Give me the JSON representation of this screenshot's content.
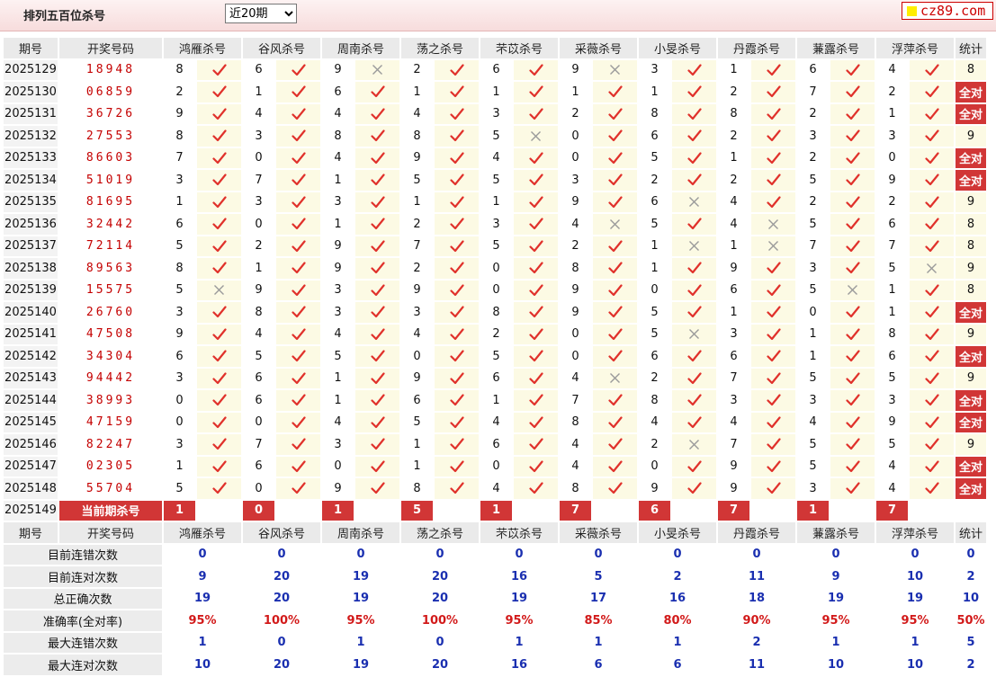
{
  "header": {
    "title": "排列五百位杀号",
    "period_select": "近20期",
    "period_options": [
      "近20期"
    ],
    "logo": "cz89.com"
  },
  "columns": {
    "issue": "期号",
    "draw": "开奖号码",
    "experts": [
      "鸿雁杀号",
      "谷风杀号",
      "周南杀号",
      "荡之杀号",
      "芣苡杀号",
      "采薇杀号",
      "小旻杀号",
      "丹霞杀号",
      "蒹露杀号",
      "浮萍杀号"
    ],
    "stat": "统计"
  },
  "all_right_label": "全对",
  "rows": [
    {
      "issue": "2025129",
      "draw": "18948",
      "kills": [
        8,
        6,
        9,
        2,
        6,
        9,
        3,
        1,
        6,
        4
      ],
      "hits": [
        1,
        1,
        0,
        1,
        1,
        0,
        1,
        1,
        1,
        1
      ],
      "stat": "8"
    },
    {
      "issue": "2025130",
      "draw": "06859",
      "kills": [
        2,
        1,
        6,
        1,
        1,
        1,
        1,
        2,
        7,
        2
      ],
      "hits": [
        1,
        1,
        1,
        1,
        1,
        1,
        1,
        1,
        1,
        1
      ],
      "stat": "全对"
    },
    {
      "issue": "2025131",
      "draw": "36726",
      "kills": [
        9,
        4,
        4,
        4,
        3,
        2,
        8,
        8,
        2,
        1
      ],
      "hits": [
        1,
        1,
        1,
        1,
        1,
        1,
        1,
        1,
        1,
        1
      ],
      "stat": "全对"
    },
    {
      "issue": "2025132",
      "draw": "27553",
      "kills": [
        8,
        3,
        8,
        8,
        5,
        0,
        6,
        2,
        3,
        3
      ],
      "hits": [
        1,
        1,
        1,
        1,
        0,
        1,
        1,
        1,
        1,
        1
      ],
      "stat": "9"
    },
    {
      "issue": "2025133",
      "draw": "86603",
      "kills": [
        7,
        0,
        4,
        9,
        4,
        0,
        5,
        1,
        2,
        0
      ],
      "hits": [
        1,
        1,
        1,
        1,
        1,
        1,
        1,
        1,
        1,
        1
      ],
      "stat": "全对"
    },
    {
      "issue": "2025134",
      "draw": "51019",
      "kills": [
        3,
        7,
        1,
        5,
        5,
        3,
        2,
        2,
        5,
        9
      ],
      "hits": [
        1,
        1,
        1,
        1,
        1,
        1,
        1,
        1,
        1,
        1
      ],
      "stat": "全对"
    },
    {
      "issue": "2025135",
      "draw": "81695",
      "kills": [
        1,
        3,
        3,
        1,
        1,
        9,
        6,
        4,
        2,
        2
      ],
      "hits": [
        1,
        1,
        1,
        1,
        1,
        1,
        0,
        1,
        1,
        1
      ],
      "stat": "9"
    },
    {
      "issue": "2025136",
      "draw": "32442",
      "kills": [
        6,
        0,
        1,
        2,
        3,
        4,
        5,
        4,
        5,
        6
      ],
      "hits": [
        1,
        1,
        1,
        1,
        1,
        0,
        1,
        0,
        1,
        1
      ],
      "stat": "8"
    },
    {
      "issue": "2025137",
      "draw": "72114",
      "kills": [
        5,
        2,
        9,
        7,
        5,
        2,
        1,
        1,
        7,
        7
      ],
      "hits": [
        1,
        1,
        1,
        1,
        1,
        1,
        0,
        0,
        1,
        1
      ],
      "stat": "8"
    },
    {
      "issue": "2025138",
      "draw": "89563",
      "kills": [
        8,
        1,
        9,
        2,
        0,
        8,
        1,
        9,
        3,
        5
      ],
      "hits": [
        1,
        1,
        1,
        1,
        1,
        1,
        1,
        1,
        1,
        0
      ],
      "stat": "9"
    },
    {
      "issue": "2025139",
      "draw": "15575",
      "kills": [
        5,
        9,
        3,
        9,
        0,
        9,
        0,
        6,
        5,
        1
      ],
      "hits": [
        0,
        1,
        1,
        1,
        1,
        1,
        1,
        1,
        0,
        1
      ],
      "stat": "8"
    },
    {
      "issue": "2025140",
      "draw": "26760",
      "kills": [
        3,
        8,
        3,
        3,
        8,
        9,
        5,
        1,
        0,
        1
      ],
      "hits": [
        1,
        1,
        1,
        1,
        1,
        1,
        1,
        1,
        1,
        1
      ],
      "stat": "全对"
    },
    {
      "issue": "2025141",
      "draw": "47508",
      "kills": [
        9,
        4,
        4,
        4,
        2,
        0,
        5,
        3,
        1,
        8
      ],
      "hits": [
        1,
        1,
        1,
        1,
        1,
        1,
        0,
        1,
        1,
        1
      ],
      "stat": "9"
    },
    {
      "issue": "2025142",
      "draw": "34304",
      "kills": [
        6,
        5,
        5,
        0,
        5,
        0,
        6,
        6,
        1,
        6
      ],
      "hits": [
        1,
        1,
        1,
        1,
        1,
        1,
        1,
        1,
        1,
        1
      ],
      "stat": "全对"
    },
    {
      "issue": "2025143",
      "draw": "94442",
      "kills": [
        3,
        6,
        1,
        9,
        6,
        4,
        2,
        7,
        5,
        5
      ],
      "hits": [
        1,
        1,
        1,
        1,
        1,
        0,
        1,
        1,
        1,
        1
      ],
      "stat": "9"
    },
    {
      "issue": "2025144",
      "draw": "38993",
      "kills": [
        0,
        6,
        1,
        6,
        1,
        7,
        8,
        3,
        3,
        3
      ],
      "hits": [
        1,
        1,
        1,
        1,
        1,
        1,
        1,
        1,
        1,
        1
      ],
      "stat": "全对"
    },
    {
      "issue": "2025145",
      "draw": "47159",
      "kills": [
        0,
        0,
        4,
        5,
        4,
        8,
        4,
        4,
        4,
        9
      ],
      "hits": [
        1,
        1,
        1,
        1,
        1,
        1,
        1,
        1,
        1,
        1
      ],
      "stat": "全对"
    },
    {
      "issue": "2025146",
      "draw": "82247",
      "kills": [
        3,
        7,
        3,
        1,
        6,
        4,
        2,
        7,
        5,
        5
      ],
      "hits": [
        1,
        1,
        1,
        1,
        1,
        1,
        0,
        1,
        1,
        1
      ],
      "stat": "9"
    },
    {
      "issue": "2025147",
      "draw": "02305",
      "kills": [
        1,
        6,
        0,
        1,
        0,
        4,
        0,
        9,
        5,
        4
      ],
      "hits": [
        1,
        1,
        1,
        1,
        1,
        1,
        1,
        1,
        1,
        1
      ],
      "stat": "全对"
    },
    {
      "issue": "2025148",
      "draw": "55704",
      "kills": [
        5,
        0,
        9,
        8,
        4,
        8,
        9,
        9,
        3,
        4
      ],
      "hits": [
        1,
        1,
        1,
        1,
        1,
        1,
        1,
        1,
        1,
        1
      ],
      "stat": "全对"
    }
  ],
  "current": {
    "issue": "2025149",
    "label": "当前期杀号",
    "kills": [
      1,
      0,
      1,
      5,
      1,
      7,
      6,
      7,
      1,
      7
    ]
  },
  "summary": [
    {
      "label": "目前连错次数",
      "values": [
        "0",
        "0",
        "0",
        "0",
        "0",
        "0",
        "0",
        "0",
        "0",
        "0",
        "0"
      ],
      "color": "blue"
    },
    {
      "label": "目前连对次数",
      "values": [
        "9",
        "20",
        "19",
        "20",
        "16",
        "5",
        "2",
        "11",
        "9",
        "10",
        "2"
      ],
      "color": "blue"
    },
    {
      "label": "总正确次数",
      "values": [
        "19",
        "20",
        "19",
        "20",
        "19",
        "17",
        "16",
        "18",
        "19",
        "19",
        "10"
      ],
      "color": "blue"
    },
    {
      "label": "准确率(全对率)",
      "values": [
        "95%",
        "100%",
        "95%",
        "100%",
        "95%",
        "85%",
        "80%",
        "90%",
        "95%",
        "95%",
        "50%"
      ],
      "color": "red"
    },
    {
      "label": "最大连错次数",
      "values": [
        "1",
        "0",
        "1",
        "0",
        "1",
        "1",
        "1",
        "2",
        "1",
        "1",
        "5"
      ],
      "color": "blue"
    },
    {
      "label": "最大连对次数",
      "values": [
        "10",
        "20",
        "19",
        "20",
        "16",
        "6",
        "6",
        "11",
        "10",
        "10",
        "2"
      ],
      "color": "blue"
    }
  ],
  "colors": {
    "check": "#e0312b",
    "cross": "#9a9a9a",
    "highlight": "#d13636",
    "blue_value": "#1a2fb0",
    "red_value": "#d21a1a"
  }
}
